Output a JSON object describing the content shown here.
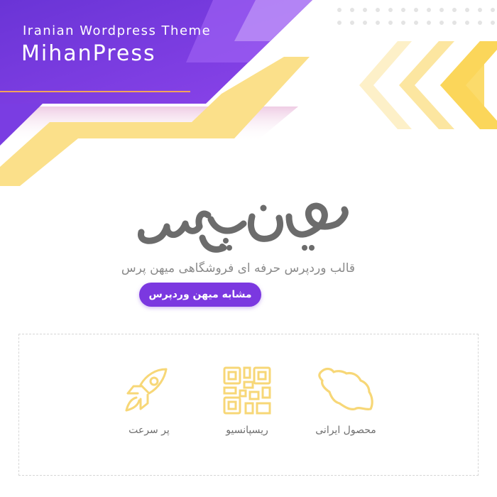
{
  "banner": {
    "subtitle": "Iranian Wordpress Theme",
    "title": "MihanPress"
  },
  "hero": {
    "logo_text": "میهن پرس",
    "tagline": "قالب وردپرس حرفه ای فروشگاهی میهن پرس",
    "cta_label": "مشابه میهن وردپرس"
  },
  "features": [
    {
      "label": "پر سرعت",
      "icon": "rocket-icon"
    },
    {
      "label": "ریسپانسیو",
      "icon": "qr-code-icon"
    },
    {
      "label": "محصول ایرانی",
      "icon": "iran-map-icon"
    }
  ],
  "colors": {
    "purple": "#7b38e0",
    "purple_light": "#9a5cf0",
    "yellow": "#fbe08a",
    "yellow_dark": "#f9d354",
    "gray_text": "#8a8a8a"
  }
}
